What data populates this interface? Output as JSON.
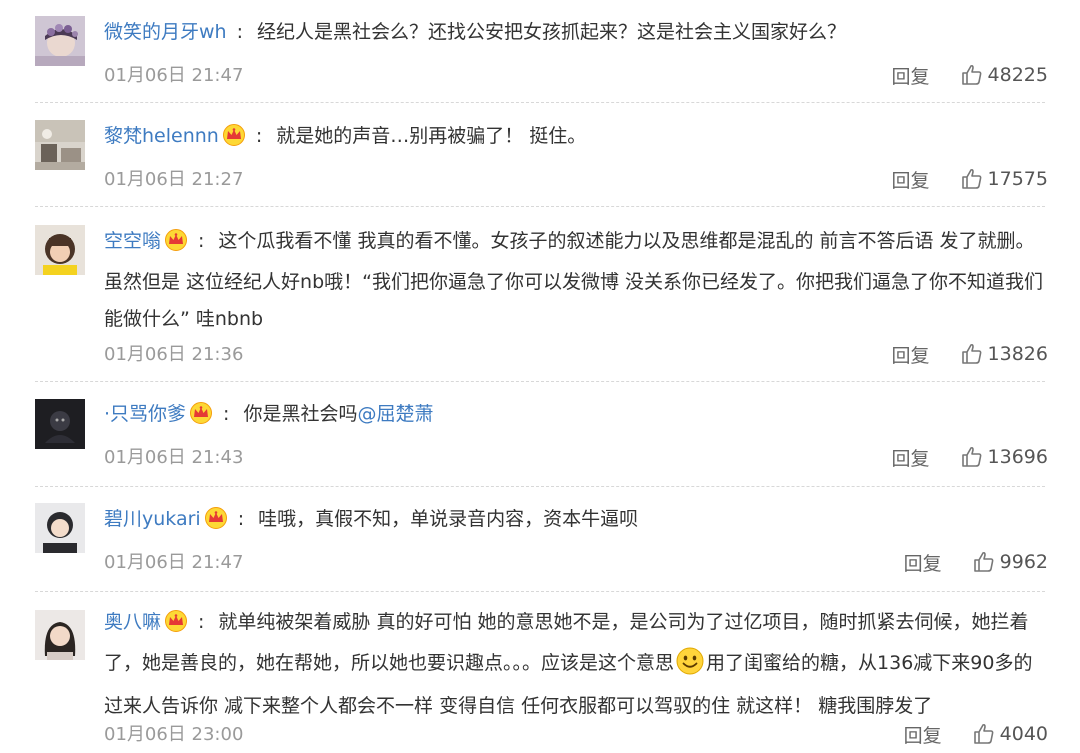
{
  "comments": [
    {
      "username": "微笑的月牙wh",
      "verified": false,
      "text": "经纪人是黑社会么？还找公安把女孩抓起来？这是社会主义国家好么？",
      "time": "01月06日 21:47",
      "reply_label": "回复",
      "likes": "48225",
      "avatar_icon": "avatar-flower"
    },
    {
      "username": "黎梵helennn",
      "verified": true,
      "text": "就是她的声音…别再被骗了！ 挺住。",
      "time": "01月06日 21:27",
      "reply_label": "回复",
      "likes": "17575",
      "avatar_icon": "avatar-room"
    },
    {
      "username": "空空嗡",
      "verified": true,
      "text": "这个瓜我看不懂 我真的看不懂。女孩子的叙述能力以及思维都是混乱的 前言不答后语 发了就删。虽然但是 这位经纪人好nb哦！“我们把你逼急了你可以发微博 没关系你已经发了。你把我们逼急了你不知道我们能做什么” 哇nbnb",
      "time": "01月06日 21:36",
      "reply_label": "回复",
      "likes": "13826",
      "avatar_icon": "avatar-girl"
    },
    {
      "username": "·只骂你爹",
      "verified": true,
      "text_before": "你是黑社会吗",
      "mention": "@屈楚萧",
      "time": "01月06日 21:43",
      "reply_label": "回复",
      "likes": "13696",
      "avatar_icon": "avatar-dark"
    },
    {
      "username": "碧川yukari",
      "verified": true,
      "text": "哇哦，真假不知，单说录音内容，资本牛逼呗",
      "time": "01月06日 21:47",
      "reply_label": "回复",
      "likes": "9962",
      "avatar_icon": "avatar-portrait"
    },
    {
      "username": "奥八嘛",
      "verified": true,
      "text_before": "就单纯被架着威胁 真的好可怕 她的意思她不是，是公司为了过亿项目，随时抓紧去伺候，她拦着了，她是善良的，她在帮她，所以她也要识趣点。。。应该是这个意思",
      "emoji": "smile-emoji",
      "text_after": "用了闺蜜给的糖，从136减下来90多的过来人告诉你 减下来整个人都会不一样 变得自信 任何衣服都可以驾驭的住 就这样！ 糖我围脖发了",
      "time": "01月06日 23:00",
      "reply_label": "回复",
      "likes": "4040",
      "avatar_icon": "avatar-woman"
    }
  ],
  "colors": {
    "username": "#3e7bc1",
    "text": "#333333",
    "meta": "#9a9a9a",
    "crown": "#f5a623"
  }
}
